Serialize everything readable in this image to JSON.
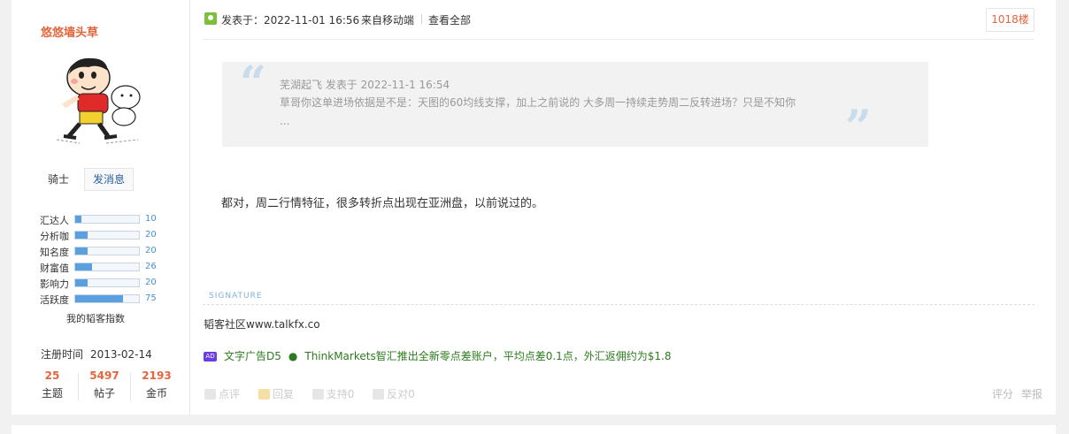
{
  "author": {
    "name": "悠悠墙头草",
    "rank": "骑士",
    "message_button": "发消息",
    "stats": [
      {
        "label": "汇达人",
        "value": "10",
        "fraction": 0.1
      },
      {
        "label": "分析咖",
        "value": "20",
        "fraction": 0.2
      },
      {
        "label": "知名度",
        "value": "20",
        "fraction": 0.2
      },
      {
        "label": "财富值",
        "value": "26",
        "fraction": 0.26
      },
      {
        "label": "影响力",
        "value": "20",
        "fraction": 0.2
      },
      {
        "label": "活跃度",
        "value": "75",
        "fraction": 0.75
      }
    ],
    "blog_index_label": "我的韬客指数",
    "register_label": "注册时间",
    "register_date": "2013-02-14",
    "counts": [
      {
        "value": "25",
        "label": "主题"
      },
      {
        "value": "5497",
        "label": "帖子"
      },
      {
        "value": "2193",
        "label": "金币"
      }
    ]
  },
  "post": {
    "posted_at": "发表于：2022-11-01 16:56",
    "source": "来自移动端",
    "view_all": "查看全部",
    "floor": "1018楼",
    "quote_header": "芜湖起飞 发表于 2022-11-1 16:54",
    "quote_body": "草哥你这单进场依据是不是：天图的60均线支撑，加上之前说的 大多周一持续走势周二反转进场？只是不知你 ...",
    "message": "都对，周二行情特征，很多转折点出现在亚洲盘，以前说过的。",
    "signature_label": "SIGNATURE",
    "signature": "韬客社区www.talkfx.co",
    "ad_badge": "AD",
    "ad_title": "文字广告D5",
    "ad_text": "ThinkMarkets智汇推出全新零点差账户，平均点差0.1点，外汇返佣约为$1.8",
    "actions": [
      "点评",
      "回复",
      "支持0",
      "反对0"
    ],
    "right_actions": [
      "评分",
      "举报"
    ]
  },
  "colors": {
    "accent": "#e4653b",
    "link": "#2c7b1c",
    "bar": "#5aa0e0"
  }
}
